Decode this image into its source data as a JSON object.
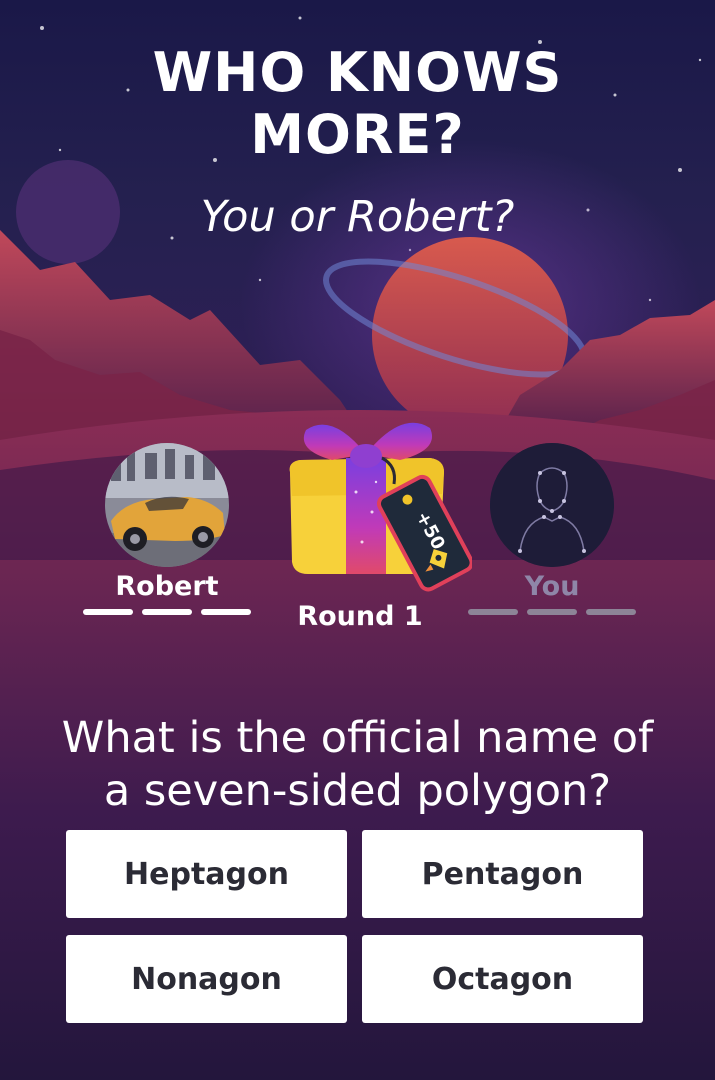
{
  "header": {
    "title_line1": "WHO KNOWS",
    "title_line2": "MORE?",
    "subtitle": "You or Robert?"
  },
  "players": {
    "opponent": {
      "name": "Robert",
      "avatar_icon": "car-photo-avatar",
      "progress_total": 3,
      "progress_done": 0
    },
    "self": {
      "name": "You",
      "avatar_icon": "person-silhouette-icon",
      "progress_total": 3,
      "progress_done": 0
    }
  },
  "round": {
    "label": "Round 1",
    "prize_icon": "gift-box-icon",
    "prize_tag": "+50",
    "tag_icon": "rocket-icon"
  },
  "question": {
    "line1": "What is the official name of",
    "line2": "a seven-sided polygon?"
  },
  "answers": [
    "Heptagon",
    "Pentagon",
    "Nonagon",
    "Octagon"
  ],
  "colors": {
    "background": "#24204f",
    "canyon": "#a8344a",
    "planet": "#c03a3f",
    "opponent_name": "#ffffff",
    "self_name": "#8f86a8",
    "opponent_dash": "#ffffff",
    "self_dash": "#8d8497",
    "gift_box": "#f7d13a",
    "answer_bg": "#ffffff",
    "answer_text": "#2b2b35"
  }
}
